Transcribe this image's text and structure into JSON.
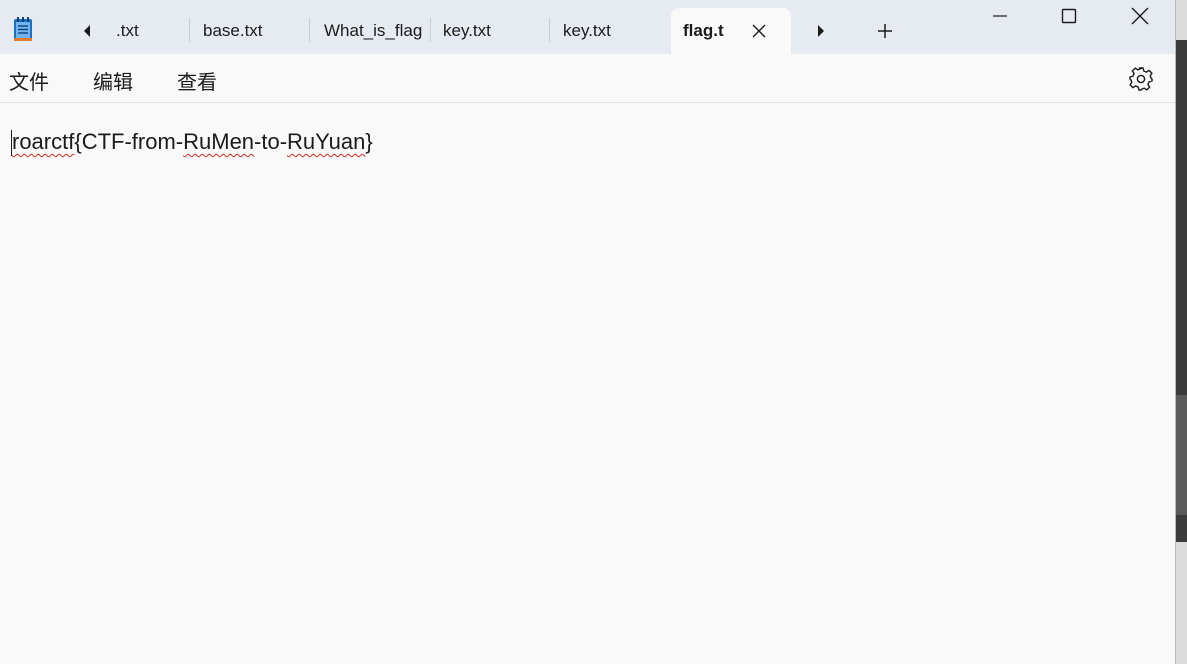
{
  "tabs": [
    {
      "label": ".txt"
    },
    {
      "label": "base.txt"
    },
    {
      "label": "What_is_flag"
    },
    {
      "label": "key.txt"
    },
    {
      "label": "key.txt"
    },
    {
      "label": "flag.t"
    }
  ],
  "menu": {
    "file": "文件",
    "edit": "编辑",
    "view": "查看"
  },
  "editor": {
    "content_parts": [
      "roarctf",
      "{CTF-from-",
      "RuMen",
      "-to-",
      "RuYuan",
      "}"
    ]
  },
  "icons": {
    "app": "notepad-icon",
    "prev": "chevron-left-icon",
    "next": "chevron-right-icon",
    "close_tab": "close-icon",
    "new_tab": "plus-icon",
    "minimize": "minimize-icon",
    "maximize": "maximize-icon",
    "close_window": "close-icon",
    "settings": "gear-icon"
  },
  "colors": {
    "titlebar": "#e6ebf2",
    "editor_bg": "#f9f9f9",
    "spell_error": "#d52b1e",
    "app_icon": "#1b6fc5"
  }
}
